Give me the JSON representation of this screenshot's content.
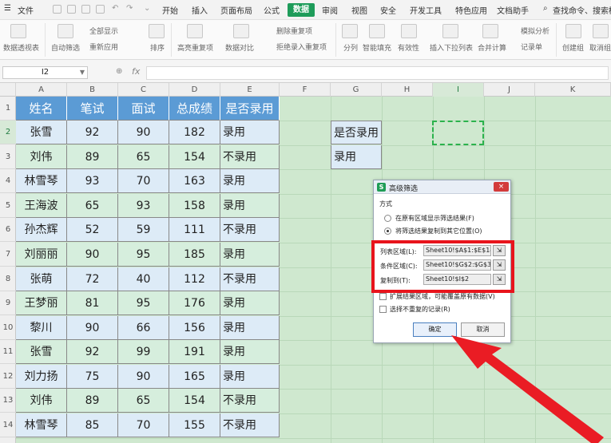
{
  "menubar": {
    "file": "文件",
    "tabs": [
      "开始",
      "插入",
      "页面布局",
      "公式",
      "数据",
      "审阅",
      "视图",
      "安全",
      "开发工具",
      "特色应用",
      "文档助手"
    ],
    "active_tab": "数据",
    "search": "查找命令、搜索模板"
  },
  "ribbon": {
    "items": [
      "数据透视表",
      "自动筛选",
      "全部显示",
      "重新应用",
      "排序",
      "高亮重复项",
      "数据对比",
      "删除重复项",
      "拒绝录入重复项",
      "分列",
      "智能填充",
      "有效性",
      "插入下拉列表",
      "合并计算",
      "模拟分析",
      "记录单",
      "创建组",
      "取消组"
    ]
  },
  "formula_bar": {
    "name_box": "I2",
    "fx": "fx"
  },
  "columns": [
    "A",
    "B",
    "C",
    "D",
    "E",
    "F",
    "G",
    "H",
    "I",
    "J",
    "K"
  ],
  "rows": [
    "1",
    "2",
    "3",
    "4",
    "5",
    "6",
    "7",
    "8",
    "9",
    "10",
    "11",
    "12",
    "13",
    "14"
  ],
  "table": {
    "headers": [
      "姓名",
      "笔试",
      "面试",
      "总成绩",
      "是否录用"
    ],
    "rows": [
      [
        "张雪",
        "92",
        "90",
        "182",
        "录用"
      ],
      [
        "刘伟",
        "89",
        "65",
        "154",
        "不录用"
      ],
      [
        "林雪琴",
        "93",
        "70",
        "163",
        "录用"
      ],
      [
        "王海波",
        "65",
        "93",
        "158",
        "录用"
      ],
      [
        "孙杰辉",
        "52",
        "59",
        "111",
        "不录用"
      ],
      [
        "刘丽丽",
        "90",
        "95",
        "185",
        "录用"
      ],
      [
        "张萌",
        "72",
        "40",
        "112",
        "不录用"
      ],
      [
        "王梦丽",
        "81",
        "95",
        "176",
        "录用"
      ],
      [
        "黎川",
        "90",
        "66",
        "156",
        "录用"
      ],
      [
        "张雪",
        "92",
        "99",
        "191",
        "录用"
      ],
      [
        "刘力扬",
        "75",
        "90",
        "165",
        "录用"
      ],
      [
        "刘伟",
        "89",
        "65",
        "154",
        "不录用"
      ],
      [
        "林雪琴",
        "85",
        "70",
        "155",
        "不录用"
      ]
    ]
  },
  "criteria": {
    "header": "是否录用",
    "value": "录用"
  },
  "dialog": {
    "title": "高级筛选",
    "close": "×",
    "method_label": "方式",
    "option1": "在原有区域显示筛选结果(F)",
    "option2": "将筛选结果复制到其它位置(O)",
    "list_label": "列表区域(L):",
    "list_value": "Sheet10!$A$1:$E$14",
    "criteria_label": "条件区域(C):",
    "criteria_value": "Sheet10!$G$2:$G$3",
    "copy_label": "复制到(T):",
    "copy_value": "Sheet10!$I$2",
    "expand_label": "扩展结果区域，可能覆盖原有数据(V)",
    "unique_label": "选择不重复的记录(R)",
    "ok": "确定",
    "cancel": "取消"
  },
  "colors": {
    "header_blue": "#5b9bd5",
    "accent_green": "#1e9c5a",
    "highlight_red": "#e8141c"
  }
}
